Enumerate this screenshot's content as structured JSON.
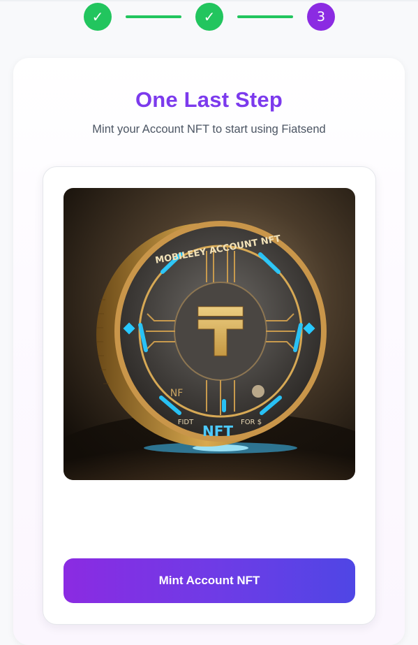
{
  "stepper": {
    "steps": [
      {
        "symbol": "✓",
        "state": "completed"
      },
      {
        "symbol": "✓",
        "state": "completed"
      },
      {
        "symbol": "3",
        "state": "current"
      }
    ]
  },
  "card": {
    "title": "One Last Step",
    "subtitle": "Mint your Account NFT to start using Fiatsend"
  },
  "nft": {
    "rim_text_top": "MOBILEEY ACCOUNT NFT",
    "rim_text_left": "NF",
    "rim_text_bottom_left": "FIDT",
    "rim_text_bottom_center": "NFT",
    "rim_text_bottom_right": "FOR $",
    "center_symbol": "₸"
  },
  "actions": {
    "mint_label": "Mint Account NFT"
  },
  "colors": {
    "accent": "#7c3aed",
    "success": "#22c55e",
    "current_step": "#8b2be2",
    "button_gradient_start": "#8b2be2",
    "button_gradient_end": "#4f46e5"
  }
}
